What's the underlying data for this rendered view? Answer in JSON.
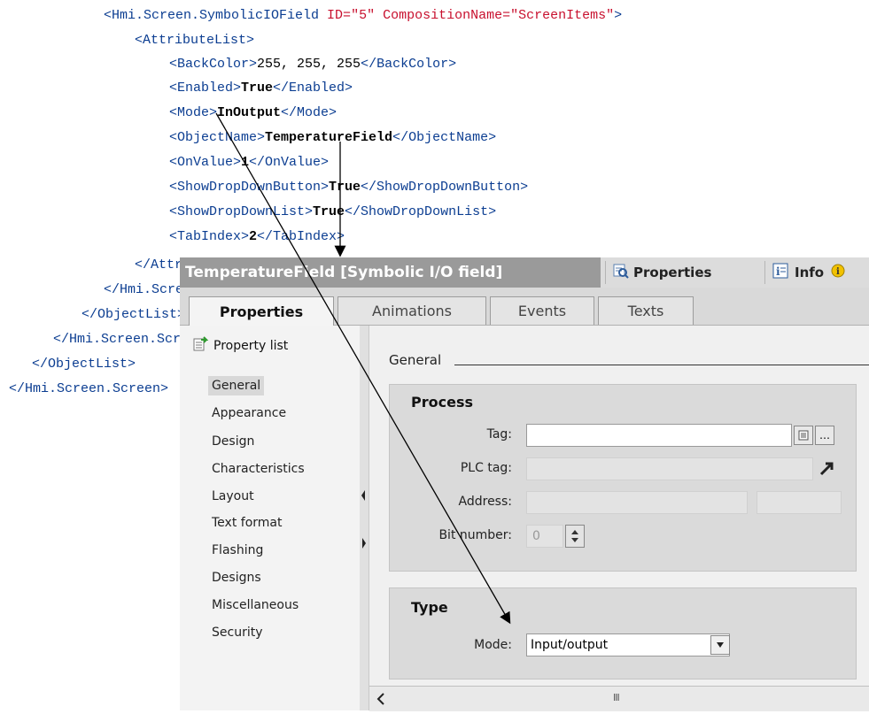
{
  "code": {
    "lines": [
      {
        "indent": 0,
        "parts": [
          [
            "tag",
            "<Hmi.Screen.SymbolicIOField "
          ],
          [
            "attr",
            "ID="
          ],
          [
            "str",
            "\"5\""
          ],
          [
            "attr",
            " CompositionName="
          ],
          [
            "str",
            "\"ScreenItems\""
          ],
          [
            "tag",
            ">"
          ]
        ]
      },
      {
        "indent": 1,
        "parts": [
          [
            "tag",
            "<AttributeList>"
          ]
        ]
      },
      {
        "indent": 2,
        "parts": [
          [
            "tag",
            "<BackColor>"
          ],
          [
            "plain",
            "255, 255, 255"
          ],
          [
            "tag",
            "</BackColor>"
          ]
        ]
      },
      {
        "indent": 2,
        "parts": [
          [
            "tag",
            "<Enabled>"
          ],
          [
            "val",
            "True"
          ],
          [
            "tag",
            "</Enabled>"
          ]
        ]
      },
      {
        "indent": 2,
        "parts": [
          [
            "tag",
            "<Mode>"
          ],
          [
            "val",
            "InOutput"
          ],
          [
            "tag",
            "</Mode>"
          ]
        ]
      },
      {
        "indent": 2,
        "parts": [
          [
            "tag",
            "<ObjectName>"
          ],
          [
            "val",
            "TemperatureField"
          ],
          [
            "tag",
            "</ObjectName>"
          ]
        ]
      },
      {
        "indent": 2,
        "parts": [
          [
            "tag",
            "<OnValue>"
          ],
          [
            "val",
            "1"
          ],
          [
            "tag",
            "</OnValue>"
          ]
        ]
      },
      {
        "indent": 2,
        "parts": [
          [
            "tag",
            "<ShowDropDownButton>"
          ],
          [
            "val",
            "True"
          ],
          [
            "tag",
            "</ShowDropDownButton>"
          ]
        ]
      },
      {
        "indent": 2,
        "parts": [
          [
            "tag",
            "<ShowDropDownList>"
          ],
          [
            "val",
            "True"
          ],
          [
            "tag",
            "</ShowDropDownList>"
          ]
        ]
      },
      {
        "indent": 2,
        "parts": [
          [
            "tag",
            "<TabIndex>"
          ],
          [
            "val",
            "2"
          ],
          [
            "tag",
            "</TabIndex>"
          ]
        ]
      },
      {
        "indent": 0,
        "parts": [
          [
            "tag",
            "</AttributeList>"
          ]
        ]
      },
      {
        "indent": 0,
        "parts": [
          [
            "tag",
            "</Hmi.Screen.SymbolicIOField>"
          ]
        ]
      },
      {
        "indent": 0,
        "parts": [
          [
            "tag",
            "</ObjectList>"
          ]
        ]
      },
      {
        "indent": 0,
        "parts": [
          [
            "tag",
            "</Hmi.Screen.Screen>"
          ]
        ]
      },
      {
        "indent": 0,
        "parts": [
          [
            "tag",
            "</ObjectList>"
          ]
        ]
      },
      {
        "indent": 0,
        "parts": [
          [
            "tag",
            "</Hmi.Screen.Screen>"
          ]
        ]
      }
    ]
  },
  "panel": {
    "title": "TemperatureField [Symbolic I/O field]",
    "top_buttons": {
      "properties": "Properties",
      "info": "Info"
    },
    "tabs": [
      "Properties",
      "Animations",
      "Events",
      "Texts"
    ],
    "property_list_label": "Property list",
    "nav_items": [
      "General",
      "Appearance",
      "Design",
      "Characteristics",
      "Layout",
      "Text format",
      "Flashing",
      "Designs",
      "Miscellaneous",
      "Security"
    ],
    "section": "General",
    "process": {
      "title": "Process",
      "tag_label": "Tag:",
      "tag_value": "",
      "plc_tag_label": "PLC tag:",
      "address_label": "Address:",
      "bit_number_label": "Bit number:",
      "bit_number_value": "0"
    },
    "type": {
      "title": "Type",
      "mode_label": "Mode:",
      "mode_value": "Input/output"
    },
    "scroll_glyph": "III"
  },
  "colors": {
    "xml_tag": "#0b3d91",
    "xml_attr": "#c8102e",
    "title_bar": "#9a9a9a"
  }
}
